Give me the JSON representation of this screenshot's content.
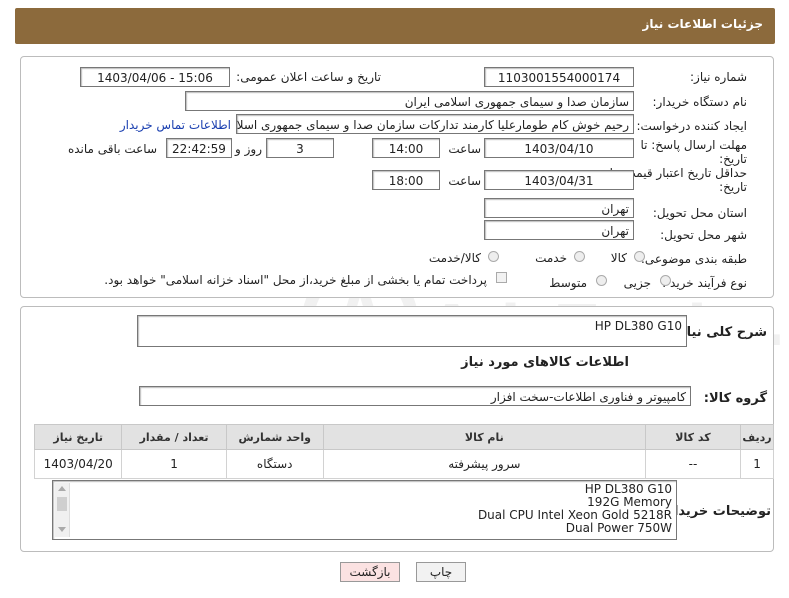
{
  "header": {
    "title": "جزئیات اطلاعات نیاز"
  },
  "form": {
    "need_number_label": "شماره نیاز:",
    "need_number": "1103001554000174",
    "announce_label": "تاریخ و ساعت اعلان عمومی:",
    "announce_value": "1403/04/06 - 15:06",
    "buyer_org_label": "نام دستگاه خریدار:",
    "buyer_org": "سازمان صدا و سیمای جمهوری اسلامی ایران",
    "creator_label": "ایجاد کننده درخواست:",
    "creator": "رحیم خوش کام طومارعلیا کارمند تدارکات سازمان صدا و سیمای جمهوری اسلامی",
    "contact_link": "اطلاعات تماس خریدار",
    "deadline_label_1": "مهلت ارسال پاسخ: تا",
    "deadline_label_2": "تاریخ:",
    "deadline_date": "1403/04/10",
    "hour_label": "ساعت",
    "deadline_time": "14:00",
    "days_value": "3",
    "days_label": "روز و",
    "remaining_time": "22:42:59",
    "remaining_label": "ساعت باقی مانده",
    "validity_label_1": "حداقل تاریخ اعتبار قیمت: تا",
    "validity_label_2": "تاریخ:",
    "validity_date": "1403/04/31",
    "validity_time": "18:00",
    "province_label": "استان محل تحویل:",
    "province": "تهران",
    "city_label": "شهر محل تحویل:",
    "city": "تهران",
    "category_label": "طبقه بندی موضوعی:",
    "category_options": [
      "کالا",
      "خدمت",
      "کالا/خدمت"
    ],
    "process_label": "نوع فرآیند خرید :",
    "process_options": [
      "جزیی",
      "متوسط"
    ],
    "payment_note": "پرداخت تمام یا بخشی از مبلغ خرید،از محل \"اسناد خزانه اسلامی\" خواهد بود."
  },
  "description": {
    "label": "شرح کلی نیاز:",
    "value": "HP DL380 G10"
  },
  "goods": {
    "section_title": "اطلاعات کالاهای مورد نیاز",
    "group_label": "گروه کالا:",
    "group_value": "کامپیوتر و فناوری اطلاعات-سخت افزار",
    "columns": [
      "ردیف",
      "کد کالا",
      "نام کالا",
      "واحد شمارش",
      "تعداد / مقدار",
      "تاریخ نیاز"
    ],
    "rows": [
      {
        "row": "1",
        "code": "--",
        "name": "سرور پیشرفته",
        "unit": "دستگاه",
        "qty": "1",
        "date": "1403/04/20"
      }
    ]
  },
  "buyer_notes": {
    "label": "توضیحات خریدار:",
    "lines": [
      "HP DL380 G10",
      "192G Memory",
      "Dual CPU Intel Xeon Gold 5218R",
      "Dual Power 750W"
    ]
  },
  "buttons": {
    "print": "چاپ",
    "back": "بازگشت"
  },
  "watermark": "AriaTender.neT",
  "colors": {
    "header_bg": "#8c6a3c",
    "link": "#1a3fb0",
    "back_button_bg": "#fbe2e2",
    "print_button_bg": "#f2f2f2"
  }
}
